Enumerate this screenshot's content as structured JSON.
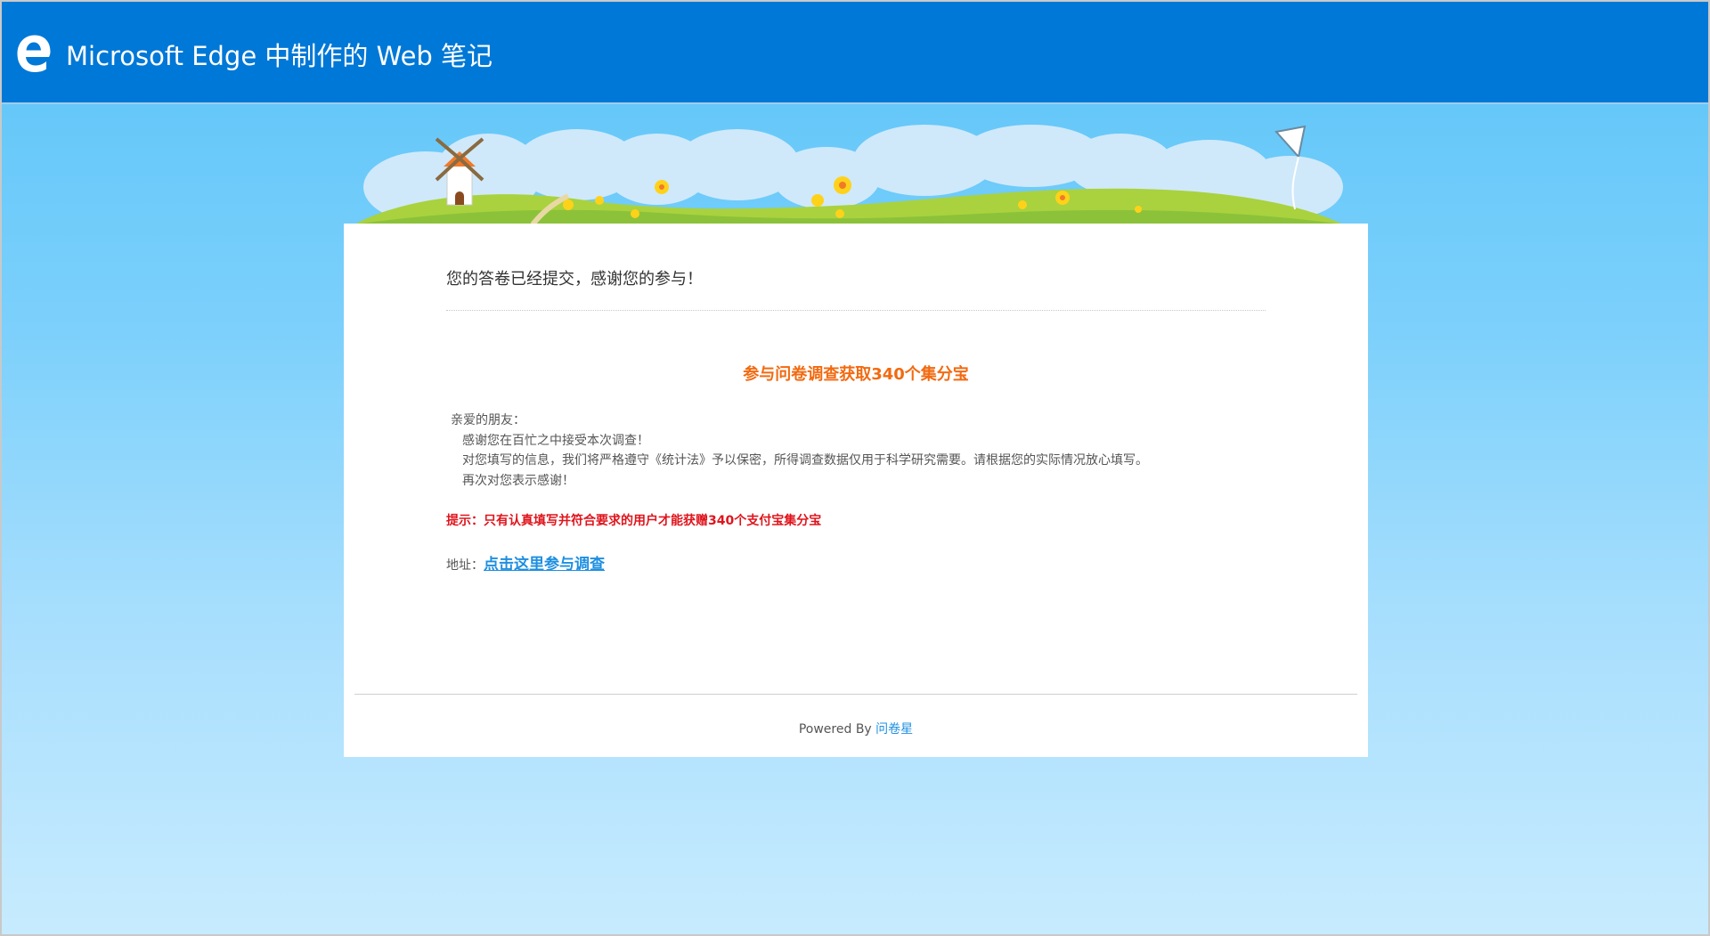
{
  "edge_banner": {
    "title": "Microsoft Edge 中制作的 Web 笔记",
    "logo_icon": "edge-e-logo-icon",
    "background_color": "#0078d7"
  },
  "header_scene": {
    "icons": [
      "windmill-icon",
      "kite-icon",
      "flower-icon",
      "cloud-icon",
      "grass-hill-icon"
    ]
  },
  "card": {
    "thanks_title": "您的答卷已经提交，感谢您的参与！",
    "promo_heading": "参与问卷调查获取340个集分宝",
    "greeting": "亲爱的朋友：",
    "body_lines": [
      "感谢您在百忙之中接受本次调查！",
      "对您填写的信息，我们将严格遵守《统计法》予以保密，所得调查数据仅用于科学研究需要。请根据您的实际情况放心填写。",
      "再次对您表示感谢！"
    ],
    "tip": "提示：只有认真填写并符合要求的用户才能获赠340个支付宝集分宝",
    "address_label": "地址：",
    "address_link": "点击这里参与调查"
  },
  "footer": {
    "powered_by": "Powered By ",
    "brand_link": "问卷星"
  },
  "colors": {
    "promo_orange": "#f26a10",
    "tip_red": "#e0141c",
    "link_blue": "#1e8fe0",
    "sky_top": "#5bc4f8",
    "sky_bottom": "#c7ebfe"
  }
}
